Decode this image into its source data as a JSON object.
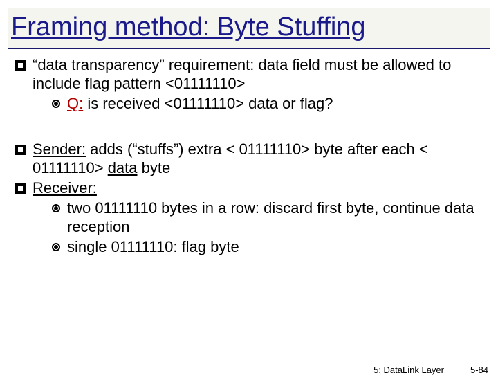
{
  "title": "Framing method: Byte Stuffing",
  "bullet1": {
    "line1a": "“data transparency” requirement:",
    "line1b": " data field must be allowed to include flag pattern  <01111110>",
    "sub_q": "Q:",
    "sub_rest": " is received <01111110> data or flag?"
  },
  "bullet2": {
    "sender": "Sender:",
    "rest1": " adds (“stuffs”) extra < 01111110> byte after each < 01111110> ",
    "data": "data",
    "rest2": "  byte"
  },
  "bullet3": {
    "receiver": "Receiver:",
    "sub1": "two 01111110 bytes in a row: discard first byte, continue data reception",
    "sub2": "single 01111110: flag byte"
  },
  "footer": {
    "section": "5: DataLink Layer",
    "page": "5-84"
  }
}
